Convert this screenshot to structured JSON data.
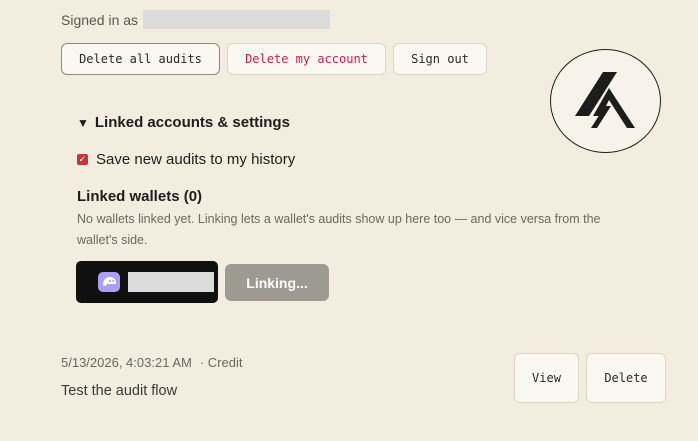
{
  "account": {
    "signed_in_label": "Signed in as"
  },
  "buttons": {
    "delete_all_audits": "Delete all audits",
    "delete_my_account": "Delete my account",
    "sign_out": "Sign out"
  },
  "settings": {
    "toggle_label": "Linked accounts & settings",
    "save_history_label": "Save new audits to my history",
    "save_history_checked": true
  },
  "wallets": {
    "title": "Linked wallets (0)",
    "description": "No wallets linked yet. Linking lets a wallet's audits show up here too — and vice versa from the wallet's side.",
    "linking_label": "Linking..."
  },
  "audit": {
    "timestamp": "5/13/2026, 4:03:21 AM",
    "type": "· Credit",
    "title": "Test the audit flow",
    "view_label": "View",
    "delete_label": "Delete"
  },
  "colors": {
    "background": "#f3ede0",
    "danger": "#c2234c",
    "checkbox": "#c9343a",
    "phantom": "#ab9ff2"
  },
  "icons": {
    "logo": "brand-logo-icon",
    "wallet": "phantom-wallet-icon"
  }
}
